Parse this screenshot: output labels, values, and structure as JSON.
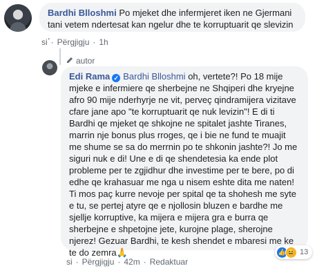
{
  "comment": {
    "author": "Bardhi Blloshmi",
    "text_line1": "Po mjeket dhe infermjeret iken ne Gjermani",
    "text_line2": "tani vetem ndertesat kan ngelur dhe te korruptuarit qe slevizin .",
    "actions": {
      "like": "si",
      "reply": "Përgjigju",
      "time": "1h"
    }
  },
  "reply": {
    "badge": "autor",
    "author": "Edi Rama",
    "mention": "Bardhi Blloshmi",
    "lines": [
      "oh, vertete?! Po 18 mije",
      "mjeke e infermiere qe sherbejne ne Shqiperi dhe kryejne",
      "afro 90 mije nderhyrje ne vit, perveç qindramijera vizitave",
      "cfare jane apo \"te korruptuarit qe nuk levizin\"! E di ti",
      "Bardhi qe mjeket qe shkojne ne spitalet jashte Tiranes,",
      "marrin nje bonus plus rroges, qe i bie ne fund te muajit",
      "me shume se sa do merrnin po te shkonin jashte?! Jo me",
      "siguri nuk e di! Une e di qe shendetesia ka ende plot",
      "probleme per te zgjidhur dhe investime per te bere, po di",
      "edhe qe krahasuar me nga u nisem eshte dita me naten!",
      "Ti mos paç kurre nevoje per spital qe ta shohesh me syte",
      "e tu, se pertej atyre qe e njollosin bluzen e bardhe me",
      "sjellje korruptive, ka mijera e mijera gra e burra qe",
      "sherbejne e shpetojne jete, kurojne plage, sherojne",
      "njerez! Gezuar Bardhi, te kesh shendet e mbaresi me ke",
      "te do zemra🙏"
    ],
    "actions": {
      "like": "si",
      "reply": "Përgjigju",
      "time": "42m",
      "edited": "Redaktuar"
    },
    "reaction_count": "13"
  },
  "colors": {
    "link": "#385898",
    "bubble": "#f2f3f5",
    "meta": "#606770"
  }
}
